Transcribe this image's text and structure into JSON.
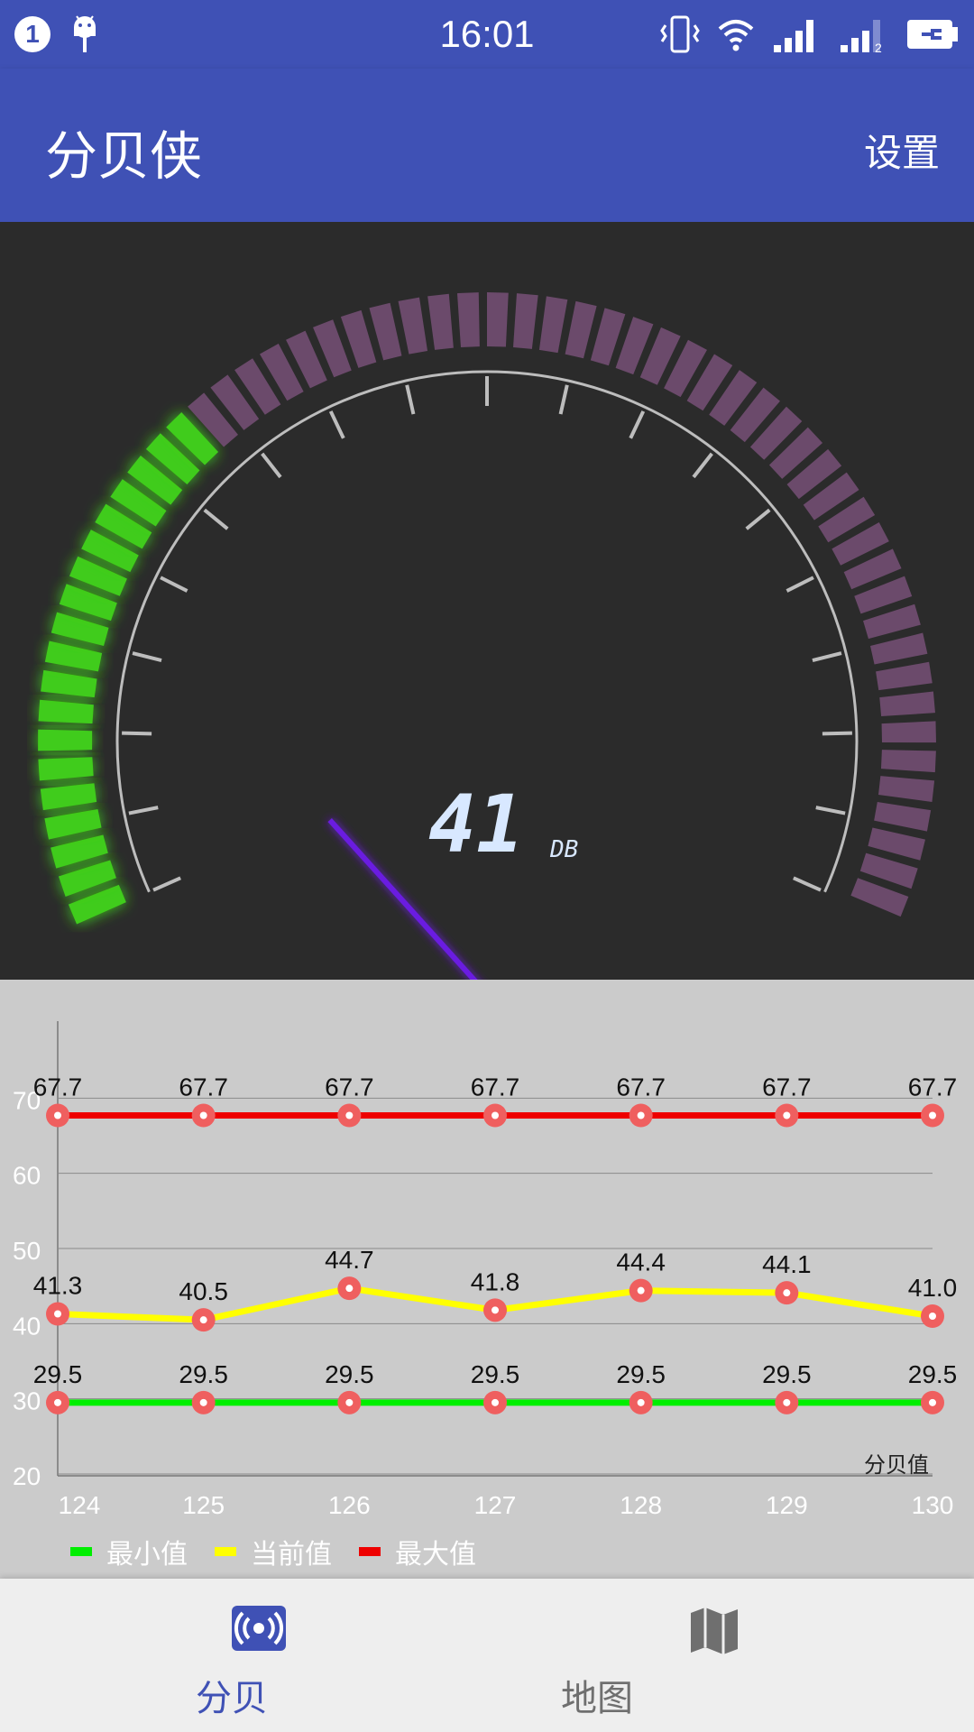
{
  "status_bar": {
    "time": "16:01",
    "notification_count": "1",
    "icons": [
      "android-icon",
      "vibrate-icon",
      "wifi-icon",
      "signal-1-icon",
      "signal-2-icon",
      "battery-icon"
    ],
    "sim2_label": "2"
  },
  "app_bar": {
    "title": "分贝侠",
    "settings_label": "设置"
  },
  "gauge": {
    "value": "41",
    "unit": "DB",
    "min": 0,
    "max": 130,
    "level": 41,
    "colors": {
      "active": "#3fcc1c",
      "inactive": "#6b4a6b",
      "needle": "#6a1ae0",
      "dial": "#bdbdbd"
    }
  },
  "chart_data": {
    "type": "line",
    "x": [
      124,
      125,
      126,
      127,
      128,
      129,
      130
    ],
    "ylim": [
      20,
      80
    ],
    "yticks": [
      20,
      30,
      40,
      50,
      60,
      70
    ],
    "ylabel": "",
    "xlabel": "分贝值",
    "series": [
      {
        "name": "最小值",
        "color": "#00ee00",
        "values": [
          29.5,
          29.5,
          29.5,
          29.5,
          29.5,
          29.5,
          29.5
        ]
      },
      {
        "name": "当前值",
        "color": "#ffff00",
        "values": [
          41.3,
          40.5,
          44.7,
          41.8,
          44.4,
          44.1,
          41.0
        ]
      },
      {
        "name": "最大值",
        "color": "#ee0000",
        "values": [
          67.7,
          67.7,
          67.7,
          67.7,
          67.7,
          67.7,
          67.7
        ]
      }
    ],
    "grid": true,
    "legend": "bottom-left",
    "point_color": "#ef5f5f"
  },
  "bottom_nav": {
    "items": [
      {
        "label": "分贝",
        "icon": "decibel-icon",
        "active": true
      },
      {
        "label": "地图",
        "icon": "map-icon",
        "active": false
      }
    ],
    "active_color": "#3f51b5",
    "inactive_color": "#6f6f6f"
  }
}
